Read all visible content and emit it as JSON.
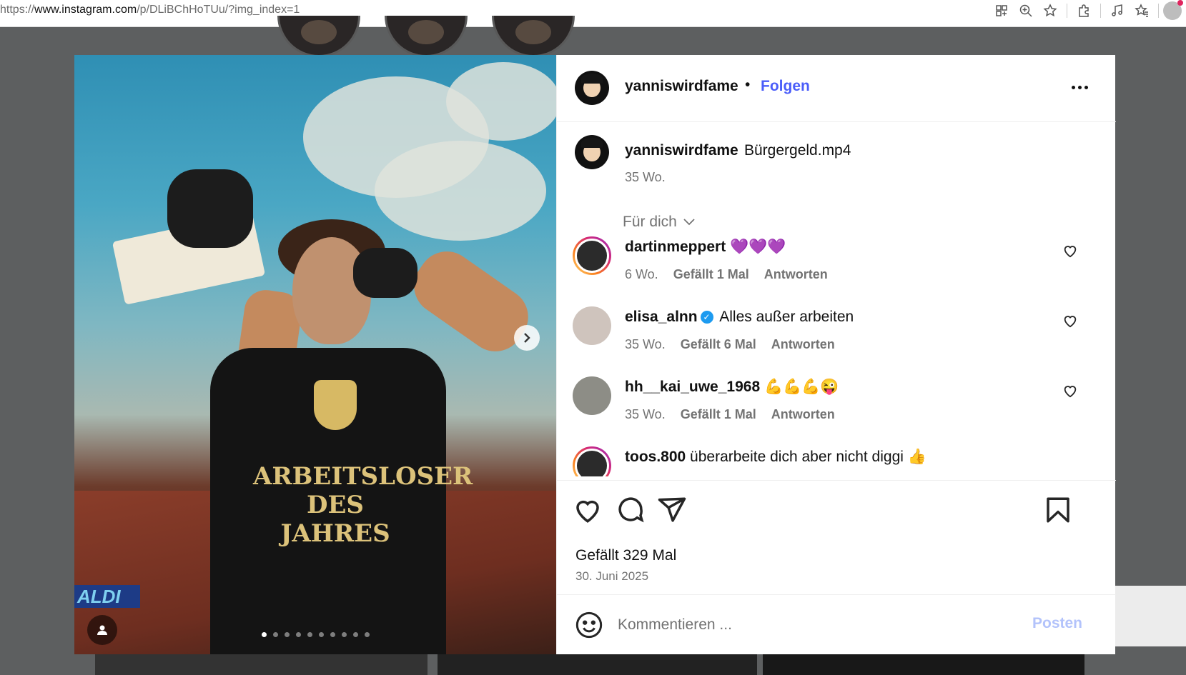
{
  "browser": {
    "url_scheme": "https://",
    "url_host": "www.instagram.com",
    "url_path": "/p/DLiBChHoTUu/?img_index=1"
  },
  "header": {
    "username": "yanniswirdfame",
    "bullet": "•",
    "follow_label": "Folgen"
  },
  "caption": {
    "username": "yanniswirdfame",
    "text": "Bürgergeld.mp4",
    "time": "35 Wo."
  },
  "comments_filter": {
    "label": "Für dich"
  },
  "comments": [
    {
      "username": "dartinmeppert",
      "text": "💜💜💜",
      "time": "6 Wo.",
      "likes": "Gefällt 1 Mal",
      "reply": "Antworten",
      "verified": false
    },
    {
      "username": "elisa_alnn",
      "text": "Alles außer arbeiten",
      "time": "35 Wo.",
      "likes": "Gefällt 6 Mal",
      "reply": "Antworten",
      "verified": true
    },
    {
      "username": "hh__kai_uwe_1968",
      "text": "💪💪💪😜",
      "time": "35 Wo.",
      "likes": "Gefällt 1 Mal",
      "reply": "Antworten",
      "verified": false
    },
    {
      "username": "toos.800",
      "text": "überarbeite dich aber nicht diggi 👍",
      "time": "",
      "likes": "",
      "reply": "",
      "verified": false
    }
  ],
  "post": {
    "likes_label": "Gefällt 329 Mal",
    "date": "30. Juni 2025",
    "carousel_total": 10,
    "carousel_current": 1,
    "image_text": {
      "shirt_line1": "ARBEITSLOSER",
      "shirt_line2": "DES JAHRES",
      "store_sign": "ALDI"
    }
  },
  "comment_box": {
    "placeholder": "Kommentieren ...",
    "post_label": "Posten"
  },
  "colors": {
    "follow_blue": "#4a5df9",
    "post_disabled": "#b3c3fb",
    "secondary_text": "#737373"
  },
  "icons": [
    "grid-icon",
    "zoom-icon",
    "star-icon",
    "extensions-icon",
    "music-icon",
    "favorites-icon",
    "heart-icon",
    "comment-icon",
    "share-icon",
    "bookmark-icon",
    "emoji-icon",
    "chevron-right-icon",
    "chevron-down-icon",
    "person-tag-icon",
    "more-icon"
  ]
}
